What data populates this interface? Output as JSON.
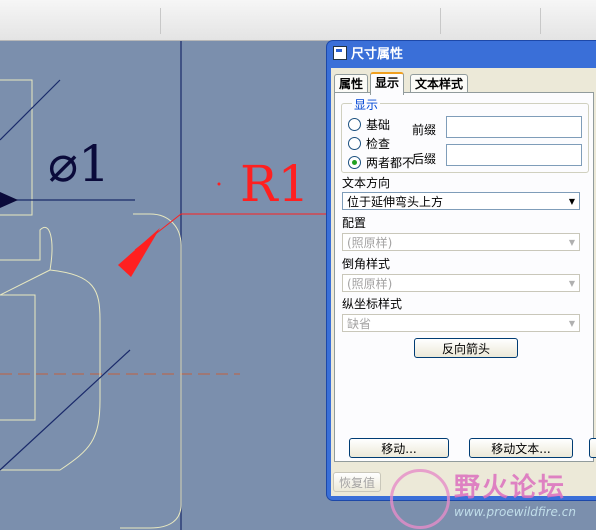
{
  "dialog": {
    "title": "尺寸属性",
    "tabs": [
      {
        "label": "属性"
      },
      {
        "label": "显示"
      },
      {
        "label": "文本样式"
      }
    ],
    "display_group": {
      "legend": "显示",
      "options": [
        {
          "label": "基础",
          "selected": false
        },
        {
          "label": "检查",
          "selected": false
        },
        {
          "label": "两者都不",
          "selected": true
        }
      ],
      "prefix_label": "前缀",
      "prefix_value": "",
      "suffix_label": "后缀",
      "suffix_value": ""
    },
    "text_direction": {
      "label": "文本方向",
      "value": "位于延伸弯头上方"
    },
    "config": {
      "label": "配置",
      "value": "(照原样)"
    },
    "chamfer_style": {
      "label": "倒角样式",
      "value": "(照原样)"
    },
    "ordinate_style": {
      "label": "纵坐标样式",
      "value": "缺省"
    },
    "flip_arrows_button": "反向箭头",
    "move_button": "移动...",
    "move_text_button": "移动文本...",
    "restore_button": "恢复值"
  },
  "drawing": {
    "diameter_label": "⌀1",
    "radius_label": "R1"
  },
  "watermark": {
    "name": "野火论坛",
    "url": "www.proewildfire.cn"
  },
  "colors": {
    "canvas": "#7b8fad",
    "dialog_title_bar": "#3a6fd8",
    "radius_dimension": "#ff2020"
  }
}
